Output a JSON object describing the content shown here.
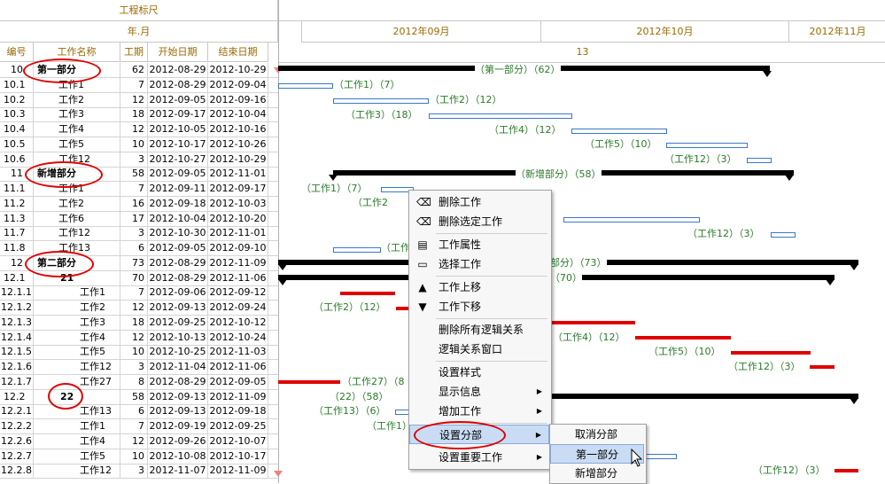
{
  "header": {
    "ruler_title": "工程标尺",
    "year_month": "年.月",
    "columns": [
      "编号",
      "工作名称",
      "工期",
      "开始日期",
      "结束日期"
    ],
    "months": [
      "2012年09月",
      "2012年10月",
      "2012年11月"
    ],
    "week_number": "13"
  },
  "rows": [
    {
      "code": "10",
      "name": "第一部分",
      "dur": "62",
      "start": "2012-08-29",
      "end": "2012-10-29",
      "bold": true
    },
    {
      "code": "10.1",
      "name": "工作1",
      "dur": "7",
      "start": "2012-08-29",
      "end": "2012-09-04"
    },
    {
      "code": "10.2",
      "name": "工作2",
      "dur": "12",
      "start": "2012-09-05",
      "end": "2012-09-16"
    },
    {
      "code": "10.3",
      "name": "工作3",
      "dur": "18",
      "start": "2012-09-17",
      "end": "2012-10-04"
    },
    {
      "code": "10.4",
      "name": "工作4",
      "dur": "12",
      "start": "2012-10-05",
      "end": "2012-10-16"
    },
    {
      "code": "10.5",
      "name": "工作5",
      "dur": "10",
      "start": "2012-10-17",
      "end": "2012-10-26"
    },
    {
      "code": "10.6",
      "name": "工作12",
      "dur": "3",
      "start": "2012-10-27",
      "end": "2012-10-29"
    },
    {
      "code": "11",
      "name": "新增部分",
      "dur": "58",
      "start": "2012-09-05",
      "end": "2012-11-01",
      "bold": true
    },
    {
      "code": "11.1",
      "name": "工作1",
      "dur": "7",
      "start": "2012-09-11",
      "end": "2012-09-17"
    },
    {
      "code": "11.2",
      "name": "工作2",
      "dur": "16",
      "start": "2012-09-18",
      "end": "2012-10-03"
    },
    {
      "code": "11.3",
      "name": "工作6",
      "dur": "17",
      "start": "2012-10-04",
      "end": "2012-10-20"
    },
    {
      "code": "11.7",
      "name": "工作12",
      "dur": "3",
      "start": "2012-10-30",
      "end": "2012-11-01"
    },
    {
      "code": "11.8",
      "name": "工作13",
      "dur": "6",
      "start": "2012-09-05",
      "end": "2012-09-10"
    },
    {
      "code": "12",
      "name": "第二部分",
      "dur": "73",
      "start": "2012-08-29",
      "end": "2012-11-09",
      "bold": true
    },
    {
      "code": "12.1",
      "name": "21",
      "dur": "70",
      "start": "2012-08-29",
      "end": "2012-11-06",
      "bold": true
    },
    {
      "code": "12.1.1",
      "name": "工作1",
      "dur": "7",
      "start": "2012-09-06",
      "end": "2012-09-12"
    },
    {
      "code": "12.1.2",
      "name": "工作2",
      "dur": "12",
      "start": "2012-09-13",
      "end": "2012-09-24"
    },
    {
      "code": "12.1.3",
      "name": "工作3",
      "dur": "18",
      "start": "2012-09-25",
      "end": "2012-10-12"
    },
    {
      "code": "12.1.4",
      "name": "工作4",
      "dur": "12",
      "start": "2012-10-13",
      "end": "2012-10-24"
    },
    {
      "code": "12.1.5",
      "name": "工作5",
      "dur": "10",
      "start": "2012-10-25",
      "end": "2012-11-03"
    },
    {
      "code": "12.1.6",
      "name": "工作12",
      "dur": "3",
      "start": "2012-11-04",
      "end": "2012-11-06"
    },
    {
      "code": "12.1.7",
      "name": "工作27",
      "dur": "8",
      "start": "2012-08-29",
      "end": "2012-09-05"
    },
    {
      "code": "12.2",
      "name": "22",
      "dur": "58",
      "start": "2012-09-13",
      "end": "2012-11-09",
      "bold": true
    },
    {
      "code": "12.2.1",
      "name": "工作13",
      "dur": "6",
      "start": "2012-09-13",
      "end": "2012-09-18"
    },
    {
      "code": "12.2.2",
      "name": "工作1",
      "dur": "7",
      "start": "2012-09-19",
      "end": "2012-09-25"
    },
    {
      "code": "12.2.6",
      "name": "工作4",
      "dur": "12",
      "start": "2012-09-26",
      "end": "2012-10-07"
    },
    {
      "code": "12.2.7",
      "name": "工作5",
      "dur": "10",
      "start": "2012-10-08",
      "end": "2012-10-17"
    },
    {
      "code": "12.2.8",
      "name": "工作12",
      "dur": "3",
      "start": "2012-11-07",
      "end": "2012-11-09"
    }
  ],
  "gantt_labels": [
    "（第一部分）（62）",
    "（工作1）（7）",
    "（工作2）（12）",
    "（工作3）（18）",
    "（工作4）（12）",
    "（工作5）（10）",
    "（工作12）（3）",
    "（新增部分）（58）",
    "（工作1）（7）",
    "（工作2",
    "（工作12）（3）",
    "（工作",
    "部分）（73）",
    "（70）",
    "（工作2）（12）",
    "（工作4）（12）",
    "（工作5）（10）",
    "（工作12）（3）",
    "（工作27）（8",
    "（22）（58）",
    "（工作13）（6）",
    "（工作1）",
    "（工作12）（3）"
  ],
  "context_menu": {
    "items": [
      {
        "label": "删除工作",
        "icon": "eraser-icon"
      },
      {
        "label": "删除选定工作",
        "icon": "eraser-icon"
      },
      {
        "label": "工作属性",
        "icon": "properties-icon"
      },
      {
        "label": "选择工作",
        "icon": "select-icon"
      },
      {
        "label": "工作上移",
        "icon": "move-up-icon"
      },
      {
        "label": "工作下移",
        "icon": "move-down-icon"
      },
      {
        "label": "删除所有逻辑关系"
      },
      {
        "label": "逻辑关系窗口"
      },
      {
        "label": "设置样式"
      },
      {
        "label": "显示信息"
      },
      {
        "label": "增加工作"
      },
      {
        "label": "设置分部"
      },
      {
        "label": "设置重要工作"
      }
    ],
    "submenu": [
      "取消分部",
      "第一部分",
      "新增部分"
    ]
  },
  "colors": {
    "accent_text": "#9a6a00",
    "label_green": "#2a7a2a",
    "critical_red": "#e00000",
    "task_blue": "#3a78c8"
  }
}
